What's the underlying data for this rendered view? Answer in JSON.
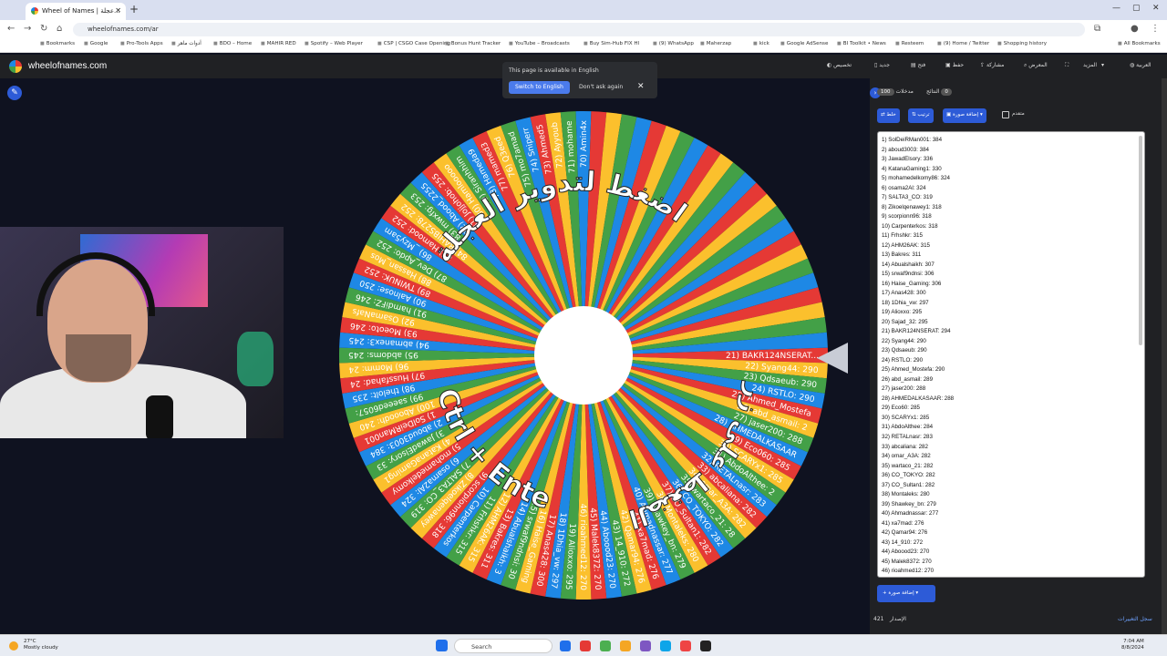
{
  "browser": {
    "tab_title": "Wheel of Names | عجلة...",
    "url": "wheelofnames.com/ar",
    "bookmarks": [
      "Bookmarks",
      "Google",
      "Pro-Tools Apps",
      "أدوات ماهر",
      "BDO – Home",
      "MAHIR RED",
      "Spotify – Web Player",
      "CSP | CSGO Case Opening",
      "Bonus Hunt Tracker",
      "YouTube – Broadcasts",
      "Buy Sim-Hub FIX Hl",
      "(9) WhatsApp",
      "Maherzap",
      "kick",
      "Google AdSense",
      "BI Toolkit • News",
      "Resteem",
      "(9) Home / Twitter",
      "Shopping history",
      "All Bookmarks"
    ]
  },
  "app": {
    "site_name": "wheelofnames.com",
    "menu": [
      "العربية",
      "المزيد",
      "المعرض",
      "مشاركة",
      "حفظ",
      "فتح",
      "جديد",
      "تخصيص"
    ]
  },
  "translate_popup": {
    "message": "This page is available in English",
    "switch_label": "Switch to English",
    "dismiss_label": "Don't ask again",
    "close_icon": "close-icon"
  },
  "wheel": {
    "colors": [
      "#e53935",
      "#fbc02d",
      "#43a047",
      "#1e88e5"
    ],
    "slice_count": 100,
    "overlay_text_1": "اضغط لتدوير العجلة",
    "overlay_text_2": "Ctrl + Enter",
    "overlay_text_3": "أو يمكنك الضغط على زر",
    "visible_slice_labels": [
      "21) BAKR124NSERAT...",
      "22) Syang44: 290",
      "23) Qdsaeub: 290",
      "24) RSTLO: 290",
      "25) Ahmed_Mostefa",
      "26) abd_asmail: 2",
      "27) jaser200: 288",
      "28) AHMEDALKASAAR",
      "29) Eco060: 285",
      "30) SCARYx1: 285",
      "31) AbdoAlthee: 2",
      "32) RETALnasr: 283",
      "33) abcaliana: 282",
      "34) omar_A3A: 282",
      "35) wartaco_21: 28",
      "36) CO_TOKYO: 282",
      "37) CO_Sultan1: 282",
      "38) Montaleks: 280",
      "39) Shawkey_bn: 279",
      "40) Ahmadnassar: 277",
      "41) xa7mad: 276",
      "42) Qamar94: 276",
      "43) 14_910: 272",
      "44) Aboood23: 270",
      "45) Malek8372: 270",
      "46) rioahmed12: 270",
      "19) Alioxxo: 295",
      "18) 1Dhia_vw: 297",
      "17) Anas428: 300",
      "16) Haise_Gaming",
      "15) srwaf9ndnsi: 30",
      "14) Abualshaikh: 3",
      "13) Bakres: 311",
      "12) AHM26AK: 315",
      "11) Frhshkr: 315",
      "10) Carpenterkos",
      "9) scorpionn96: 318",
      "8) Zikoelqenawey",
      "7) SALTA3_CO: 319",
      "6) osama2Al: 324",
      "5) mohamedelkomy",
      "4) KatanaGaming1",
      "3) JawadElsory: 33",
      "2) aboud3003: 384",
      "1) SolDeiRMan001",
      "100) Abooodh: 240",
      "99) saeeed6057: ",
      "98) thelolt: 235",
      "97) Hussfahad: 24",
      "96) Momm: 24",
      "95) abdoms: 245",
      "94) abmanex3: 245",
      "93) Moeoto: 246",
      "92) OsamaNafs",
      "91) hamdiFZ: 246",
      "90) Aalnose: 250",
      "89) TWINUK: 252",
      "88) Hassan_Mos",
      "87) Dev_Apdo: 252",
      "86) _Mzy5am",
      "85) Hamood: 252",
      "84) RAHIBS278: 252",
      "83) mwxfg: 253",
      "82) Abood_2255",
      "81) Jojjohob: 255",
      "80) Hamlooooo",
      "79) Siranhhim",
      "78) Hameda9",
      "77) mamed3",
      "76) Q3eed",
      "75) mo7amad",
      "74) Sniperr",
      "73) Ahmed5",
      "72) Ayyoub",
      "71) mohame",
      "70) Amin4x"
    ]
  },
  "sidebar": {
    "entries_tab_label": "مدخلات",
    "entries_count": "100",
    "results_tab_label": "النتائج",
    "results_count": "0",
    "shuffle_label": "خلط",
    "sort_label": "ترتيب",
    "add_image_label": "إضافة صورة",
    "advanced_label": "متقدم",
    "entries": [
      "1) SolDeiRMan001: 384",
      "2) aboud3003: 384",
      "3) JawadElsory: 336",
      "4) KatanaGaming1: 330",
      "5) mohamedelkomy86: 324",
      "6) osama2Al: 324",
      "7) SALTA3_CO: 319",
      "8) Zikoelqenawey1: 318",
      "9) scorpionn96: 318",
      "10) Carpenterkos: 318",
      "11) Frhshkr: 315",
      "12) AHM26AK: 315",
      "13) Bakres: 311",
      "14) Abualshaikh: 307",
      "15) srwaf9ndnsi: 306",
      "16) Haise_Gaming: 306",
      "17) Anas428: 300",
      "18) 1Dhia_vw: 297",
      "19) Alioxxo: 295",
      "20) Sajad_32: 295",
      "21) BAKR124NSERAT: 294",
      "22) Syang44: 290",
      "23) Qdsaeub: 290",
      "24) RSTLO: 290",
      "25) Ahmed_Mostefa: 290",
      "26) abd_asmail: 289",
      "27) jaser200: 288",
      "28) AHMEDALKASAAR: 288",
      "29) Eco60: 285",
      "30) SCARYx1: 285",
      "31) AbdoAlthee: 284",
      "32) RETALnasr: 283",
      "33) abcaliana: 282",
      "34) omar_A3A: 282",
      "35) wartaco_21: 282",
      "36) CO_TOKYO: 282",
      "37) CO_Sultan1: 282",
      "38) Montaleks: 280",
      "39) Shawkey_bn: 279",
      "40) Ahmadnassar: 277",
      "41) xa7mad: 276",
      "42) Qamar94: 276",
      "43) 14_910: 272",
      "44) Aboood23: 270",
      "45) Malek8372: 270",
      "46) rioahmed12: 270"
    ],
    "add_image_button_label": "إضافة صورة",
    "version_label": "الإصدار",
    "version_number": "421",
    "changelog_label": "سجل التغييرات"
  },
  "taskbar": {
    "weather_temp": "27°C",
    "weather_desc": "Mostly cloudy",
    "search_placeholder": "Search",
    "time": "7:04 AM",
    "date": "8/8/2024",
    "tray_colors": [
      "#1f6feb",
      "#e53935",
      "#4caf50",
      "#f5a623",
      "#7e57c2",
      "#0ea5e9",
      "#ef4444",
      "#222222"
    ]
  }
}
